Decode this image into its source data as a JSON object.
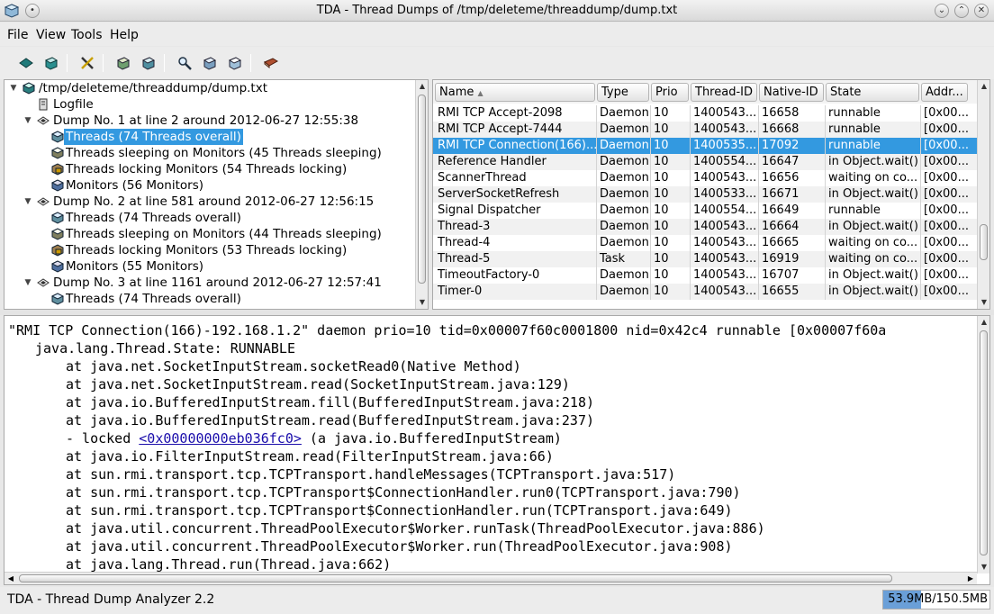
{
  "window": {
    "title": "TDA - Thread Dumps of /tmp/deleteme/threaddump/dump.txt"
  },
  "menu": {
    "items": [
      "File",
      "View",
      "Tools",
      "Help"
    ]
  },
  "toolbar": {
    "buttons": [
      "open-dump-icon",
      "open-logfile-icon",
      "settings-icon",
      "expand-icon",
      "collapse-icon",
      "find-icon",
      "filter-icon",
      "custom-category-icon",
      "help-book-icon"
    ]
  },
  "tree": {
    "root": "/tmp/deleteme/threaddump/dump.txt",
    "logfile": "Logfile",
    "dumps": [
      {
        "label": "Dump No. 1 at line 2 around 2012-06-27 12:55:38",
        "children": [
          "Threads (74 Threads overall)",
          "Threads sleeping on Monitors (45 Threads sleeping)",
          "Threads locking Monitors (54 Threads locking)",
          "Monitors (56 Monitors)"
        ]
      },
      {
        "label": "Dump No. 2 at line 581 around 2012-06-27 12:56:15",
        "children": [
          "Threads (74 Threads overall)",
          "Threads sleeping on Monitors (44 Threads sleeping)",
          "Threads locking Monitors (53 Threads locking)",
          "Monitors (55 Monitors)"
        ]
      },
      {
        "label": "Dump No. 3 at line 1161 around 2012-06-27 12:57:41",
        "children": [
          "Threads (74 Threads overall)"
        ]
      }
    ]
  },
  "table": {
    "columns": [
      "Name",
      "Type",
      "Prio",
      "Thread-ID",
      "Native-ID",
      "State",
      "Addr..."
    ],
    "sort_indicator": "▲",
    "rows": [
      [
        "RMI TCP Accept-2098",
        "Daemon",
        "10",
        "1400543...",
        "16658",
        "runnable",
        "[0x00..."
      ],
      [
        "RMI TCP Accept-7444",
        "Daemon",
        "10",
        "1400543...",
        "16668",
        "runnable",
        "[0x00..."
      ],
      [
        "RMI TCP Connection(166)...",
        "Daemon",
        "10",
        "1400535...",
        "17092",
        "runnable",
        "[0x00..."
      ],
      [
        "Reference Handler",
        "Daemon",
        "10",
        "1400554...",
        "16647",
        "in Object.wait()",
        "[0x00..."
      ],
      [
        "ScannerThread",
        "Daemon",
        "10",
        "1400543...",
        "16656",
        "waiting on co...",
        "[0x00..."
      ],
      [
        "ServerSocketRefresh",
        "Daemon",
        "10",
        "1400533...",
        "16671",
        "in Object.wait()",
        "[0x00..."
      ],
      [
        "Signal Dispatcher",
        "Daemon",
        "10",
        "1400554...",
        "16649",
        "runnable",
        "[0x00..."
      ],
      [
        "Thread-3",
        "Daemon",
        "10",
        "1400543...",
        "16664",
        "in Object.wait()",
        "[0x00..."
      ],
      [
        "Thread-4",
        "Daemon",
        "10",
        "1400543...",
        "16665",
        "waiting on co...",
        "[0x00..."
      ],
      [
        "Thread-5",
        "Task",
        "10",
        "1400543...",
        "16919",
        "waiting on co...",
        "[0x00..."
      ],
      [
        "TimeoutFactory-0",
        "Daemon",
        "10",
        "1400543...",
        "16707",
        "in Object.wait()",
        "[0x00..."
      ],
      [
        "Timer-0",
        "Daemon",
        "10",
        "1400543...",
        "16655",
        "in Object.wait()",
        "[0x00..."
      ]
    ]
  },
  "detail": {
    "header": "\"RMI TCP Connection(166)-192.168.1.2\" daemon prio=10 tid=0x00007f60c0001800 nid=0x42c4 runnable [0x00007f60a",
    "state": "java.lang.Thread.State: RUNNABLE",
    "frames": [
      "at java.net.SocketInputStream.socketRead0(Native Method)",
      "at java.net.SocketInputStream.read(SocketInputStream.java:129)",
      "at java.io.BufferedInputStream.fill(BufferedInputStream.java:218)",
      "at java.io.BufferedInputStream.read(BufferedInputStream.java:237)"
    ],
    "locked_prefix": "- locked ",
    "locked_link": "<0x00000000eb036fc0>",
    "locked_suffix": " (a java.io.BufferedInputStream)",
    "frames2": [
      "at java.io.FilterInputStream.read(FilterInputStream.java:66)",
      "at sun.rmi.transport.tcp.TCPTransport.handleMessages(TCPTransport.java:517)",
      "at sun.rmi.transport.tcp.TCPTransport$ConnectionHandler.run0(TCPTransport.java:790)",
      "at sun.rmi.transport.tcp.TCPTransport$ConnectionHandler.run(TCPTransport.java:649)",
      "at java.util.concurrent.ThreadPoolExecutor$Worker.runTask(ThreadPoolExecutor.java:886)",
      "at java.util.concurrent.ThreadPoolExecutor$Worker.run(ThreadPoolExecutor.java:908)",
      "at java.lang.Thread.run(Thread.java:662)"
    ]
  },
  "status": {
    "text": "TDA - Thread Dump Analyzer 2.2",
    "memory": "53.9MB/150.5MB",
    "memory_used_fraction": 0.36
  },
  "colors": {
    "selection": "#3399e0",
    "link": "#1a0dab"
  }
}
